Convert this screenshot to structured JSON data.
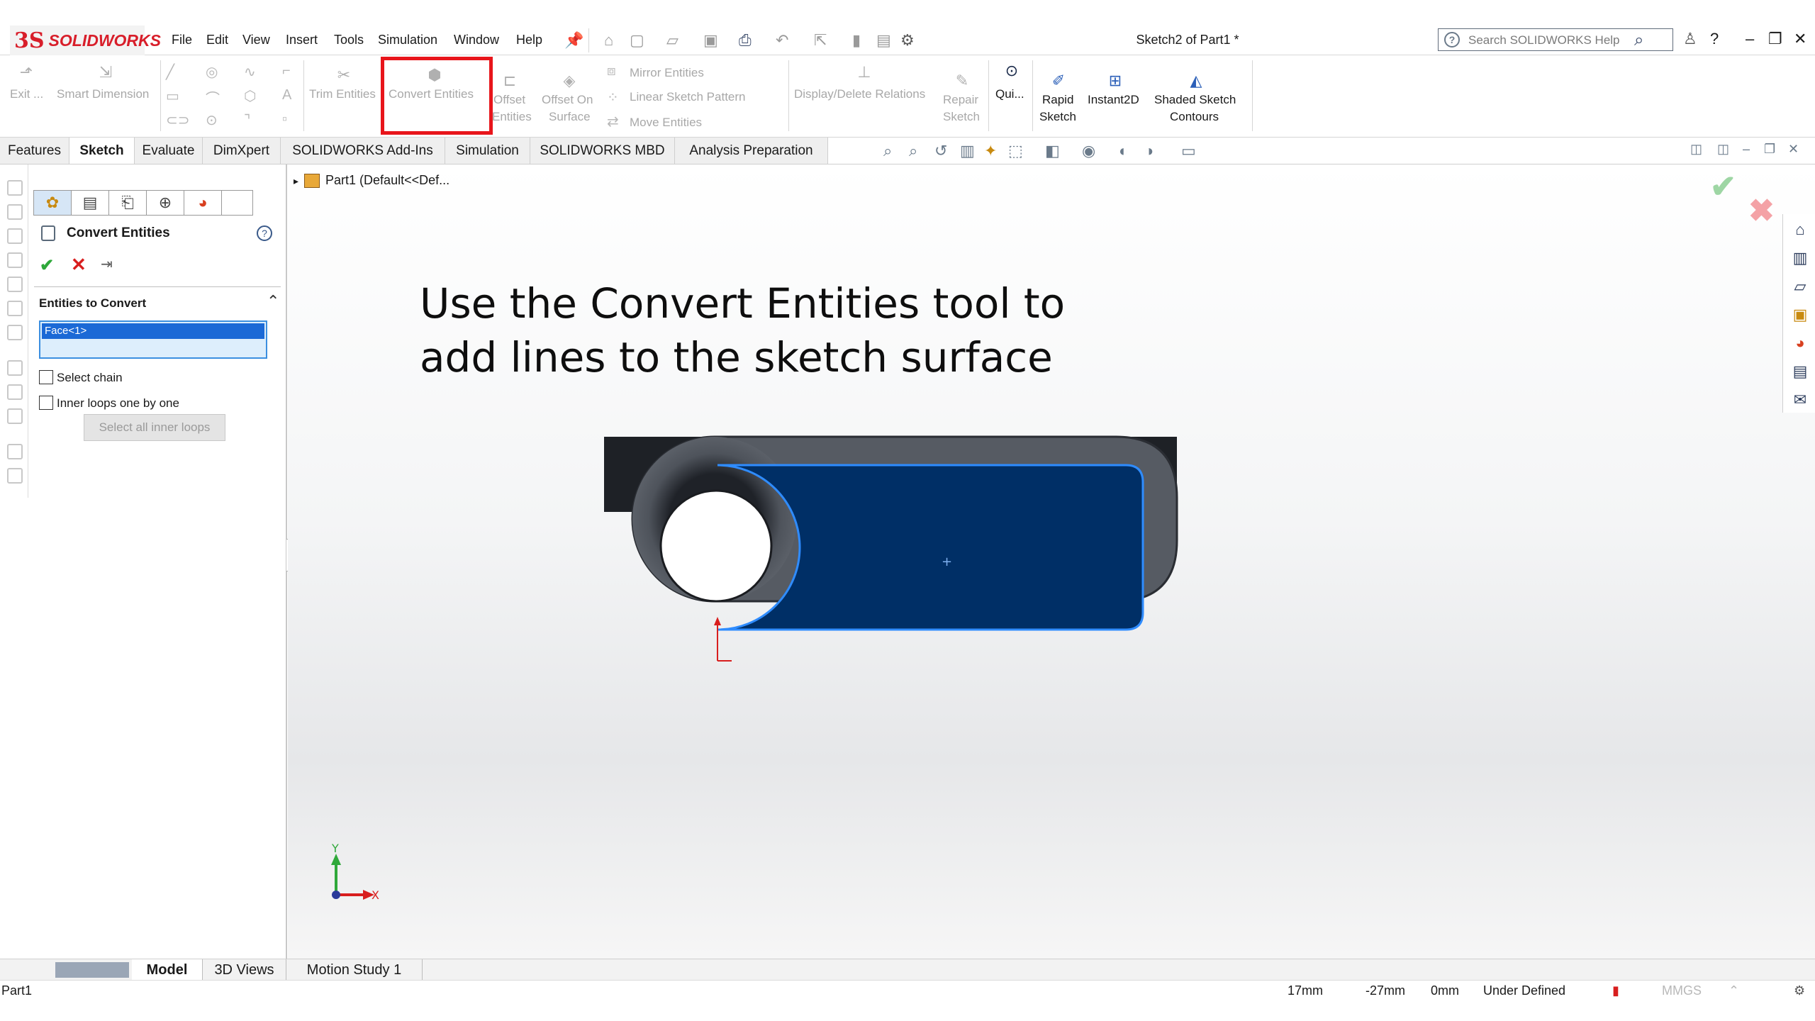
{
  "app": {
    "brand": "SOLIDWORKS",
    "brand_mark": "3S"
  },
  "menu": {
    "items": [
      "File",
      "Edit",
      "View",
      "Insert",
      "Tools",
      "Simulation",
      "Window",
      "Help"
    ]
  },
  "document_title": "Sketch2 of Part1 *",
  "search": {
    "placeholder": "Search SOLIDWORKS Help"
  },
  "commands": {
    "exit": "Exit ...",
    "smart_dimension": "Smart Dimension",
    "trim": "Trim Entities",
    "convert": "Convert Entities",
    "offset_entities": [
      "Offset",
      "Entities"
    ],
    "offset_on_surface": [
      "Offset On",
      "Surface"
    ],
    "mirror": "Mirror Entities",
    "linear_pattern": "Linear Sketch Pattern",
    "move": "Move Entities",
    "display_relations": "Display/Delete Relations",
    "repair": [
      "Repair",
      "Sketch"
    ],
    "quick": "Qui...",
    "rapid": [
      "Rapid",
      "Sketch"
    ],
    "instant2d": "Instant2D",
    "shaded": [
      "Shaded Sketch",
      "Contours"
    ]
  },
  "tabs": [
    "Features",
    "Sketch",
    "Evaluate",
    "DimXpert",
    "SOLIDWORKS Add-Ins",
    "Simulation",
    "SOLIDWORKS MBD",
    "Analysis Preparation"
  ],
  "active_tab": "Sketch",
  "property_manager": {
    "title": "Convert Entities",
    "section": "Entities to Convert",
    "selected": "Face<1>",
    "select_chain": "Select chain",
    "inner_loops": "Inner loops one by one",
    "select_all_inner": "Select all inner loops"
  },
  "tree": {
    "root": "Part1  (Default<<Def..."
  },
  "caption": [
    "Use the Convert Entities tool to",
    "add lines to the sketch surface"
  ],
  "triad": {
    "x": "X",
    "y": "Y"
  },
  "bottom_tabs": [
    "Model",
    "3D Views",
    "Motion Study 1"
  ],
  "status": {
    "file": "Part1",
    "x": "17mm",
    "y": "-27mm",
    "z": "0mm",
    "state": "Under Defined",
    "units": "MMGS"
  },
  "colors": {
    "part_body": "#4a4f57",
    "selected_face": "#002f66",
    "face_edge": "#2f8cff",
    "highlight_box": "#e8151b"
  }
}
